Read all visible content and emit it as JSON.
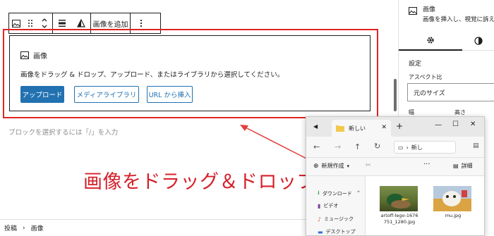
{
  "toolbar": {
    "buttons": [
      "image-icon",
      "drag-handle-icon",
      "move-up-down-icon",
      "align-icon",
      "warning-icon"
    ],
    "add_image_label": "画像を追加",
    "more_icon": "more-vertical-icon"
  },
  "image_block": {
    "label": "画像",
    "instructions": "画像をドラッグ & ドロップ、アップロード、またはライブラリから選択してください。",
    "upload_label": "アップロード",
    "media_library_label": "メディアライブラリ",
    "insert_from_url_label": "URL から挿入"
  },
  "placeholder": "ブロックを選択するには「/」を入力",
  "annotation": "画像をドラッグ＆ドロップ",
  "breadcrumb": [
    "投稿",
    "›",
    "画像"
  ],
  "sidebar": {
    "block_title": "画像",
    "block_description": "画像を挿入し、視覚に訴え",
    "settings_heading": "設定",
    "aspect_ratio_label": "アスペクト比",
    "aspect_ratio_value": "元のサイズ",
    "width_label": "幅",
    "height_label": "高さ"
  },
  "explorer": {
    "tab_title": "新しい",
    "address_text": "新し",
    "new_button_label": "新規作成",
    "details_label": "詳細",
    "nav_items": [
      "ダウンロード",
      "ビデオ",
      "ミュージック",
      "デスクトップ"
    ],
    "files": [
      {
        "name": "artoff-lego-1676751_1280.jpg"
      },
      {
        "name": "mu.jpg"
      }
    ]
  },
  "colors": {
    "highlight_red": "#e02424",
    "primary_blue": "#2271b1",
    "annotation_red": "#d6202a"
  }
}
